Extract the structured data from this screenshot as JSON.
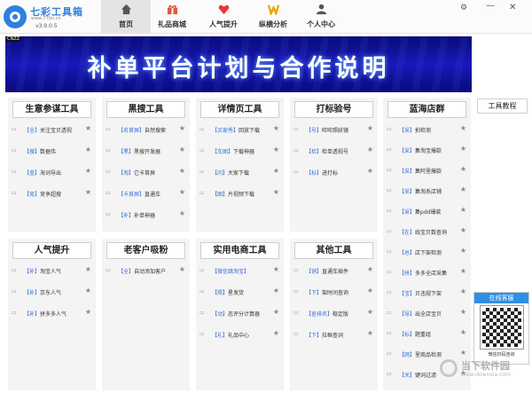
{
  "app": {
    "name": "七彩工具箱",
    "site": "www.77bn.cn",
    "version": "v3.9.0.5"
  },
  "nav": [
    {
      "label": "首页",
      "icon": "home-icon",
      "active": true
    },
    {
      "label": "礼品商城",
      "icon": "gift-icon",
      "active": false
    },
    {
      "label": "人气提升",
      "icon": "heart-icon",
      "active": false
    },
    {
      "label": "纵横分析",
      "icon": "chart-icon",
      "active": false
    },
    {
      "label": "个人中心",
      "icon": "person-icon",
      "active": false
    }
  ],
  "window": {
    "settings_icon": "gear-icon",
    "minimize_label": "—",
    "close_label": "✕"
  },
  "banner": {
    "cnzz": "CNZZ",
    "title": "补单平台计划与合作说明"
  },
  "sections": [
    {
      "title": "生意参谋工具",
      "items": [
        {
          "tag": "【全】",
          "text": "关注宝贝透视"
        },
        {
          "tag": "【搜】",
          "text": "数据伟"
        },
        {
          "tag": "【查】",
          "text": "海词导出"
        },
        {
          "tag": "【竞】",
          "text": "竞争超搜"
        }
      ]
    },
    {
      "title": "黑搜工具",
      "items": [
        {
          "tag": "【名首屏】",
          "text": "自然搜索"
        },
        {
          "tag": "【黑】",
          "text": "黑搜开发器"
        },
        {
          "tag": "【淘】",
          "text": "它卡首屏"
        },
        {
          "tag": "【卡首屏】",
          "text": "直通车"
        },
        {
          "tag": "【补】",
          "text": "补单神器"
        }
      ]
    },
    {
      "title": "详情页工具",
      "items": [
        {
          "tag": "【买家秀】",
          "text": "回放下载"
        },
        {
          "tag": "【车图】",
          "text": "下载神器"
        },
        {
          "tag": "【问】",
          "text": "大家下载"
        },
        {
          "tag": "【图】",
          "text": "片视频下载"
        }
      ]
    },
    {
      "title": "打标验号",
      "items": [
        {
          "tag": "【号】",
          "text": "旺旺照妖镜"
        },
        {
          "tag": "【检】",
          "text": "检单透视号"
        },
        {
          "tag": "【标】",
          "text": "进打标"
        }
      ]
    },
    {
      "title": "蓝海店群",
      "items": [
        {
          "tag": "【采】",
          "text": "拍检测"
        },
        {
          "tag": "【采】",
          "text": "集淘宝爆款"
        },
        {
          "tag": "【采】",
          "text": "集阿里爆款"
        },
        {
          "tag": "【采】",
          "text": "集淘系店铺"
        },
        {
          "tag": "【采】",
          "text": "集pdd爆款"
        },
        {
          "tag": "【在】",
          "text": "线宝贝数查询"
        },
        {
          "tag": "【总】",
          "text": "店下架检测"
        },
        {
          "tag": "【拼】",
          "text": "多多全店采集"
        },
        {
          "tag": "【宝】",
          "text": "贝违规下架"
        },
        {
          "tag": "【导】",
          "text": "出全店宝贝"
        },
        {
          "tag": "【标】",
          "text": "题重组"
        },
        {
          "tag": "【网】",
          "text": "里商品检测"
        },
        {
          "tag": "【关】",
          "text": "键词过滤"
        }
      ]
    },
    {
      "title": "人气提升",
      "items": [
        {
          "tag": "【补】",
          "text": "淘宝人气"
        },
        {
          "tag": "【补】",
          "text": "京东人气"
        },
        {
          "tag": "【补】",
          "text": "拼多多人气"
        }
      ]
    },
    {
      "title": "老客户吸粉",
      "items": [
        {
          "tag": "【全】",
          "text": "自动添加客户"
        }
      ]
    },
    {
      "title": "实用电商工具",
      "items": [
        {
          "tag": "【微信跳淘宝】",
          "text": ""
        },
        {
          "tag": "【照】",
          "text": "星发货"
        },
        {
          "tag": "【动】",
          "text": "态评分计算器"
        },
        {
          "tag": "【礼】",
          "text": "礼品中心"
        }
      ]
    },
    {
      "title": "其他工具",
      "items": [
        {
          "tag": "【销】",
          "text": "直通车插件"
        },
        {
          "tag": "【下】",
          "text": "架时间查询"
        },
        {
          "tag": "【查排名】",
          "text": "稳定版"
        },
        {
          "tag": "【下】",
          "text": "拉框查词"
        }
      ]
    }
  ],
  "sidebar": {
    "tools_tab": "工具教程",
    "service_title": "在线客服",
    "qr_caption": "微信扫码咨询"
  },
  "watermark": {
    "text": "当下软件园",
    "url": "www.downxia.com"
  },
  "icons": {
    "play": "play-icon",
    "star": "star-icon"
  }
}
